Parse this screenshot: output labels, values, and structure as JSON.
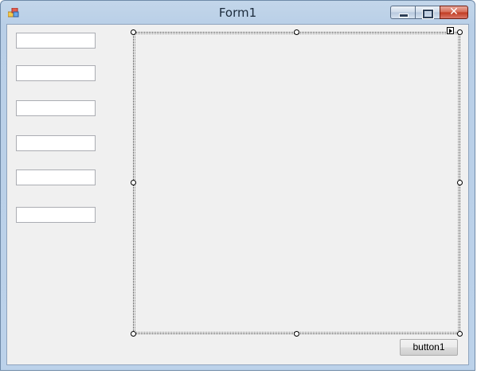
{
  "window": {
    "title": "Form1",
    "caption_buttons": {
      "minimize": "minimize",
      "maximize": "maximize",
      "close": "close"
    }
  },
  "form": {
    "textboxes": [
      "",
      "",
      "",
      "",
      "",
      ""
    ],
    "button1_label": "button1"
  },
  "colors": {
    "titlebar": "#c3d6ea",
    "client_background": "#f0f0f0",
    "close_button": "#c0391f"
  }
}
